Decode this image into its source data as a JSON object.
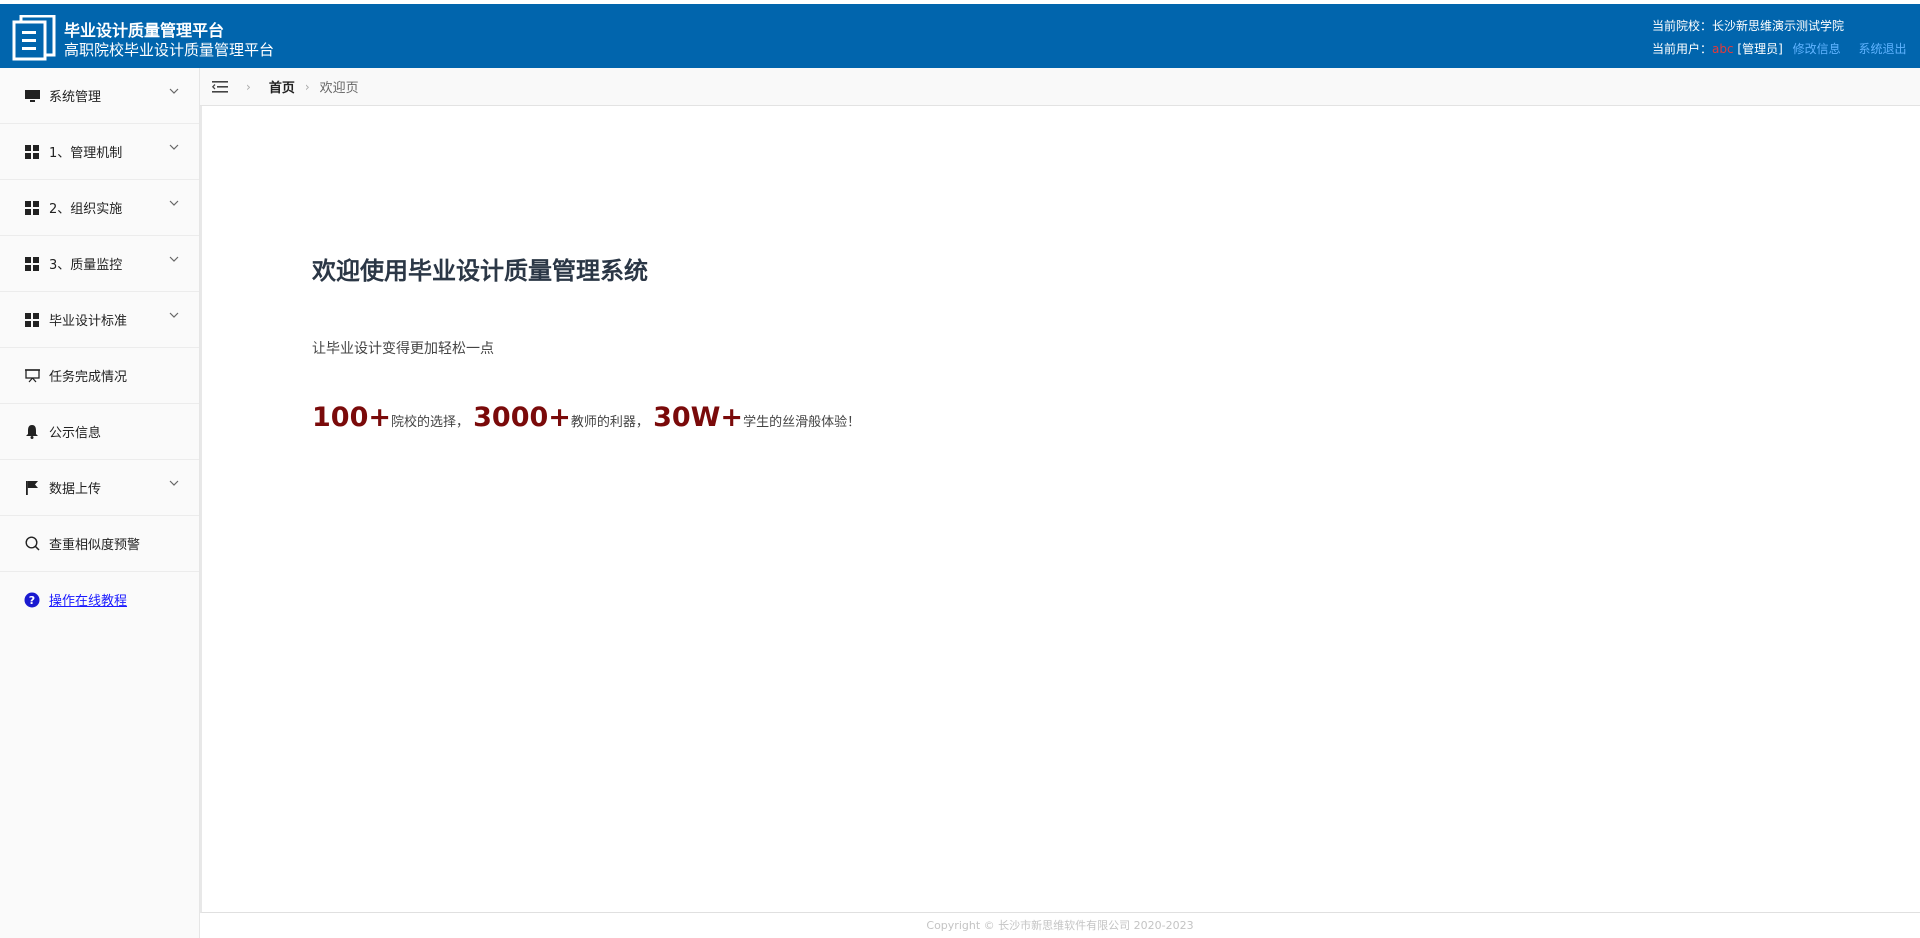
{
  "header": {
    "title": "毕业设计质量管理平台",
    "subtitle": "高职院校毕业设计质量管理平台",
    "school_label": "当前院校：",
    "school_name": "长沙新思维演示测试学院",
    "user_label": "当前用户：",
    "user_name": "abc",
    "user_role": "[管理员]",
    "edit_info": "修改信息",
    "logout": "系统退出"
  },
  "sidebar": {
    "items": [
      {
        "label": "系统管理",
        "icon": "monitor-icon",
        "expandable": true
      },
      {
        "label": "1、管理机制",
        "icon": "grid-icon",
        "expandable": true
      },
      {
        "label": "2、组织实施",
        "icon": "grid-icon",
        "expandable": true
      },
      {
        "label": "3、质量监控",
        "icon": "grid-icon",
        "expandable": true
      },
      {
        "label": "毕业设计标准",
        "icon": "grid-icon",
        "expandable": true
      },
      {
        "label": "任务完成情况",
        "icon": "presentation-icon",
        "expandable": false
      },
      {
        "label": "公示信息",
        "icon": "bell-icon",
        "expandable": false
      },
      {
        "label": "数据上传",
        "icon": "flag-icon",
        "expandable": true
      },
      {
        "label": "查重相似度预警",
        "icon": "search-icon",
        "expandable": false
      },
      {
        "label": "操作在线教程",
        "icon": "help-icon",
        "expandable": false
      }
    ]
  },
  "breadcrumb": {
    "home": "首页",
    "current": "欢迎页"
  },
  "main": {
    "title": "欢迎使用毕业设计质量管理系统",
    "subtitle": "让毕业设计变得更加轻松一点",
    "stats": [
      {
        "num": "100+",
        "text": "院校的选择，"
      },
      {
        "num": "3000+",
        "text": "教师的利器，"
      },
      {
        "num": "30W+",
        "text": "学生的丝滑般体验！"
      }
    ]
  },
  "footer": {
    "copyright": "Copyright © 长沙市新思维软件有限公司 2020-2023"
  },
  "colors": {
    "header_bg": "#0165ad",
    "accent_number": "#7a0a0a",
    "link_blue": "#5fb3ff"
  }
}
